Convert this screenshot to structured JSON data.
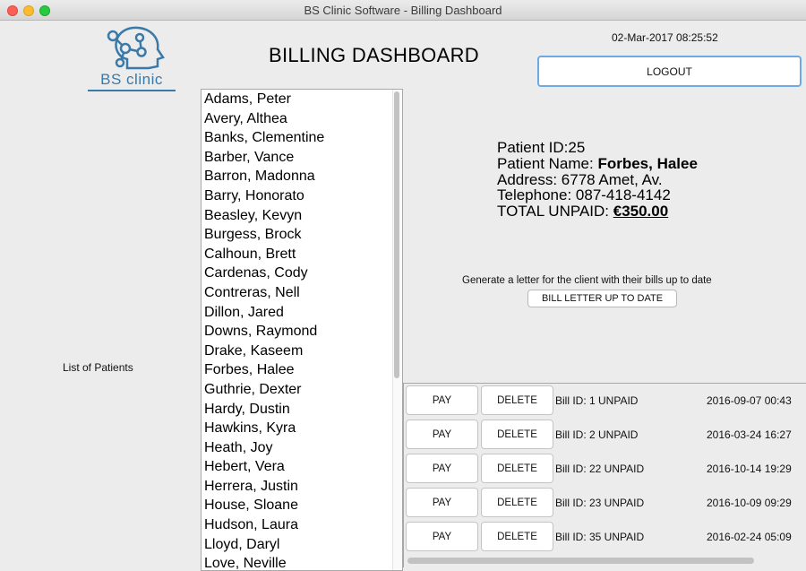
{
  "window": {
    "title": "BS Clinic Software - Billing Dashboard"
  },
  "header": {
    "logo_text": "BS clinic",
    "title": "BILLING DASHBOARD",
    "datetime": "02-Mar-2017 08:25:52",
    "logout_label": "LOGOUT"
  },
  "sidebar": {
    "list_label": "List of Patients"
  },
  "patients": [
    "Adams, Peter",
    "Avery, Althea",
    "Banks, Clementine",
    "Barber, Vance",
    "Barron, Madonna",
    "Barry, Honorato",
    "Beasley, Kevyn",
    "Burgess, Brock",
    "Calhoun, Brett",
    "Cardenas, Cody",
    "Contreras, Nell",
    "Dillon, Jared",
    "Downs, Raymond",
    "Drake, Kaseem",
    "Forbes, Halee",
    "Guthrie, Dexter",
    "Hardy, Dustin",
    "Hawkins, Kyra",
    "Heath, Joy",
    "Hebert, Vera",
    "Herrera, Justin",
    "House, Sloane",
    "Hudson, Laura",
    "Lloyd, Daryl",
    "Love, Neville"
  ],
  "patient_info": {
    "id_label": "Patient ID:",
    "id_value": "25",
    "name_label": "Patient Name: ",
    "name_value": "Forbes, Halee",
    "address": "Address: 6778 Amet, Av.",
    "telephone": "Telephone: 087-418-4142",
    "total_label": "TOTAL UNPAID: ",
    "total_value": "€350.00"
  },
  "letter": {
    "description": "Generate a letter for the client with their bills up to date",
    "button_label": "BILL LETTER UP TO DATE"
  },
  "bills": [
    {
      "pay": "PAY",
      "delete": "DELETE",
      "id_text": "Bill ID: 1 UNPAID",
      "date": "2016-09-07 00:43"
    },
    {
      "pay": "PAY",
      "delete": "DELETE",
      "id_text": "Bill ID: 2 UNPAID",
      "date": "2016-03-24 16:27"
    },
    {
      "pay": "PAY",
      "delete": "DELETE",
      "id_text": "Bill ID: 22 UNPAID",
      "date": "2016-10-14 19:29"
    },
    {
      "pay": "PAY",
      "delete": "DELETE",
      "id_text": "Bill ID: 23 UNPAID",
      "date": "2016-10-09 09:29"
    },
    {
      "pay": "PAY",
      "delete": "DELETE",
      "id_text": "Bill ID: 35 UNPAID",
      "date": "2016-02-24 05:09"
    }
  ],
  "colors": {
    "accent": "#3a79a8",
    "focus_border": "#6fa8e6"
  }
}
